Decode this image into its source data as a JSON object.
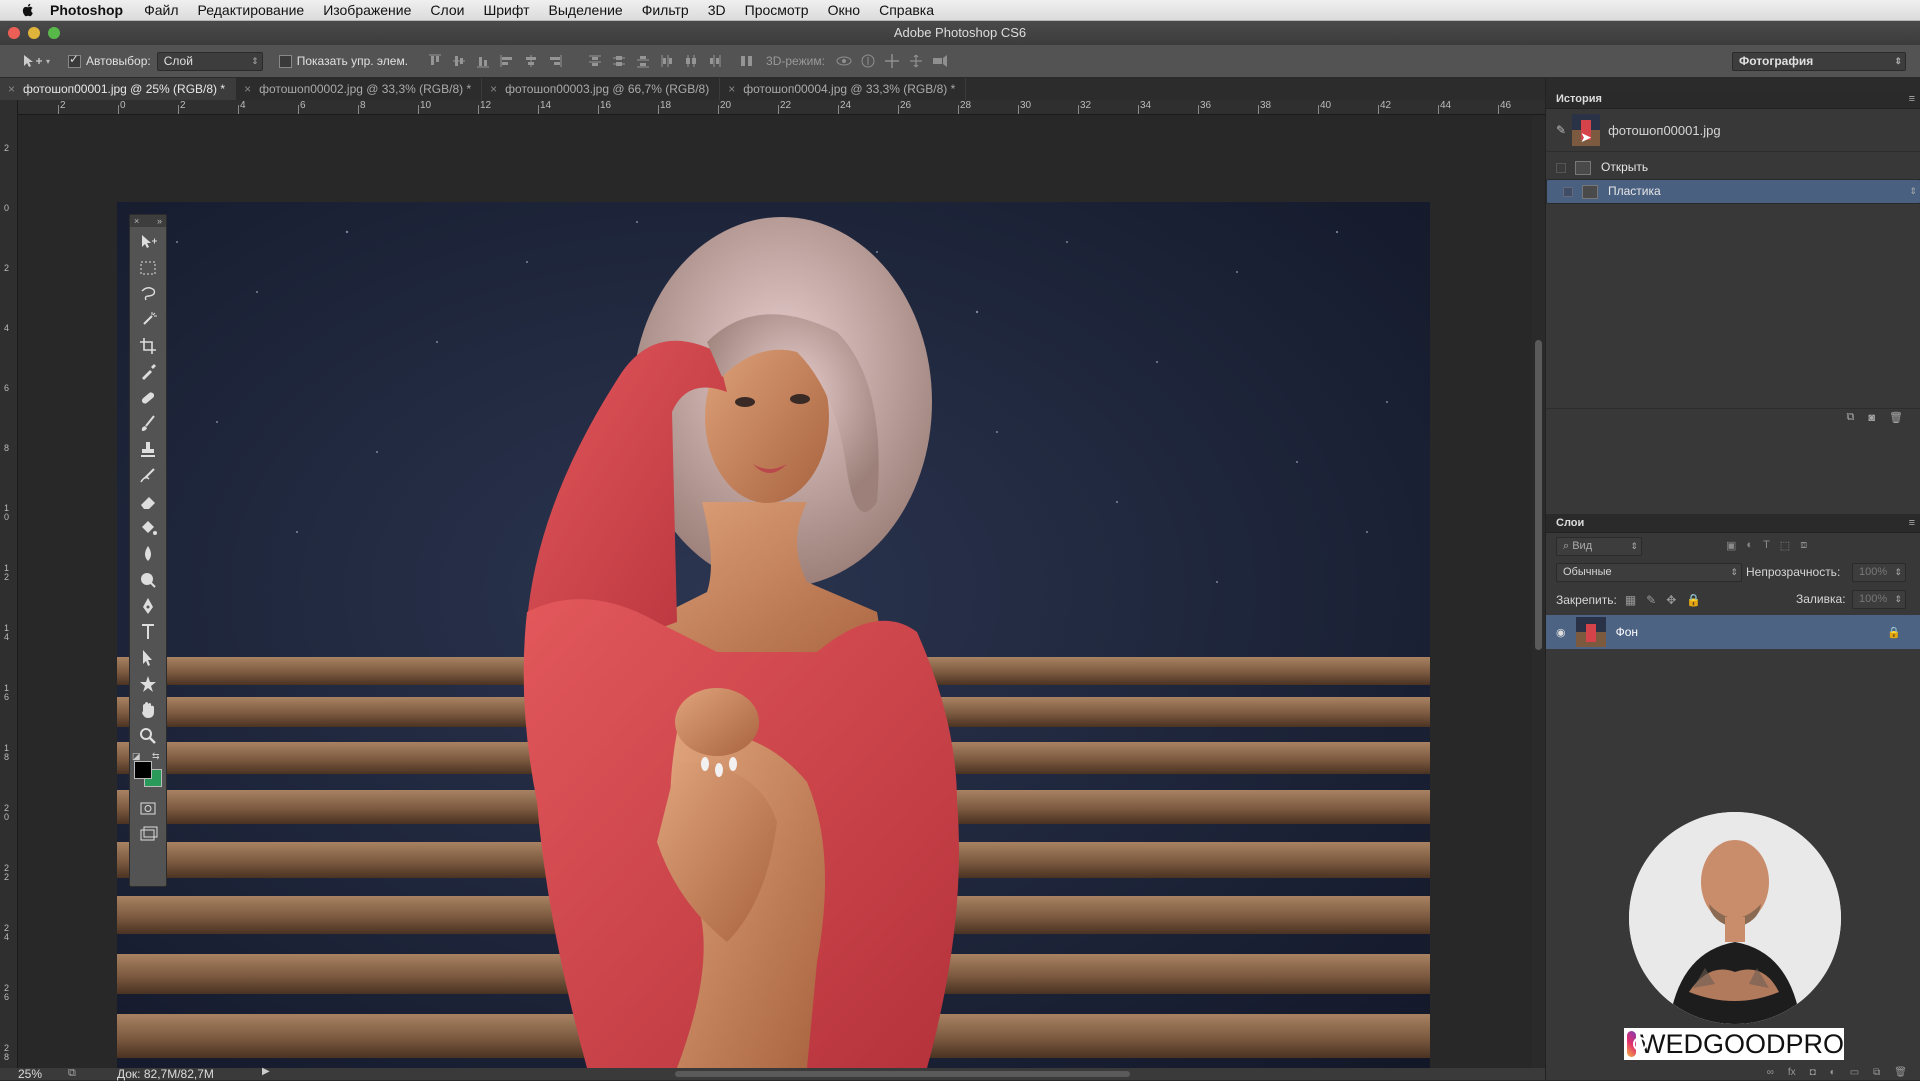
{
  "menubar": {
    "app": "Photoshop",
    "items": [
      "Файл",
      "Редактирование",
      "Изображение",
      "Слои",
      "Шрифт",
      "Выделение",
      "Фильтр",
      "3D",
      "Просмотр",
      "Окно",
      "Справка"
    ]
  },
  "window": {
    "title": "Adobe Photoshop CS6"
  },
  "options": {
    "autoselect_label": "Автовыбор:",
    "autoselect_value": "Слой",
    "show_transform_label": "Показать упр. элем.",
    "mode3d_label": "3D-режим:",
    "workspace": "Фотография"
  },
  "tabs": [
    {
      "label": "фотошоп00001.jpg @ 25% (RGB/8) *",
      "active": true
    },
    {
      "label": "фотошоп00002.jpg @ 33,3% (RGB/8) *",
      "active": false
    },
    {
      "label": "фотошоп00003.jpg @ 66,7% (RGB/8)",
      "active": false
    },
    {
      "label": "фотошоп00004.jpg @ 33,3% (RGB/8) *",
      "active": false
    }
  ],
  "ruler": {
    "h_ticks": [
      "2",
      "0",
      "2",
      "4",
      "6",
      "8",
      "10",
      "12",
      "14",
      "16",
      "18",
      "20",
      "22",
      "24",
      "26",
      "28",
      "30",
      "32",
      "34",
      "36",
      "38",
      "40",
      "42",
      "44",
      "46"
    ],
    "v_ticks": [
      "2",
      "0",
      "2",
      "4",
      "6",
      "8",
      "1\n0",
      "1\n2",
      "1\n4",
      "1\n6",
      "1\n8",
      "2\n0",
      "2\n2",
      "2\n4",
      "2\n6",
      "2\n8"
    ]
  },
  "status": {
    "zoom": "25%",
    "doc": "Док: 82,7M/82,7M"
  },
  "history": {
    "title": "История",
    "snapshot": "фотошоп00001.jpg",
    "items": [
      {
        "label": "Открыть",
        "selected": false
      },
      {
        "label": "Пластика",
        "selected": true
      }
    ]
  },
  "layers": {
    "title": "Слои",
    "filter": "Вид",
    "blend_mode": "Обычные",
    "opacity_label": "Непрозрачность:",
    "opacity_value": "100%",
    "lock_label": "Закрепить:",
    "fill_label": "Заливка:",
    "fill_value": "100%",
    "items": [
      {
        "name": "Фон",
        "locked": true,
        "visible": true
      }
    ]
  },
  "watermark": {
    "handle": "WEDGOODPRO"
  },
  "colors": {
    "accent_selection": "#4a6081",
    "panel_bg": "#383838",
    "sweater": "#d4424a"
  }
}
